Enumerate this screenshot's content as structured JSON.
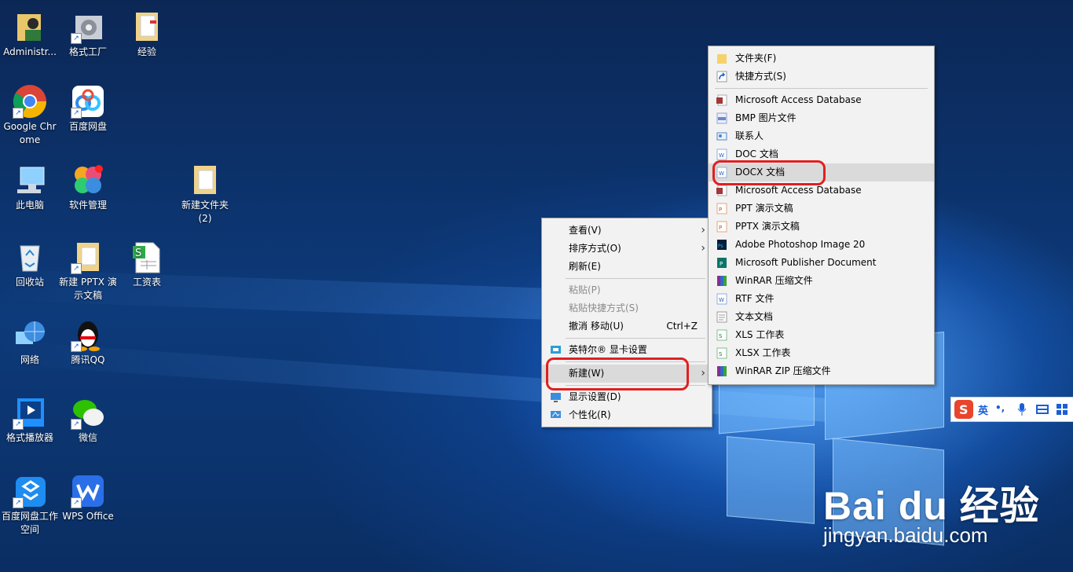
{
  "desktop": {
    "icons": [
      {
        "label": "Administr..."
      },
      {
        "label": "格式工厂"
      },
      {
        "label": "经验"
      },
      {
        "label": "Google Chrome"
      },
      {
        "label": "百度网盘"
      },
      {
        "label": "此电脑"
      },
      {
        "label": "软件管理"
      },
      {
        "label": "新建文件夹 (2)"
      },
      {
        "label": "回收站"
      },
      {
        "label": "新建 PPTX 演示文稿"
      },
      {
        "label": "工资表"
      },
      {
        "label": "网络"
      },
      {
        "label": "腾讯QQ"
      },
      {
        "label": "格式播放器"
      },
      {
        "label": "微信"
      },
      {
        "label": "百度网盘工作空间"
      },
      {
        "label": "WPS Office"
      }
    ]
  },
  "context_menu": {
    "items": [
      {
        "label": "查看(V)"
      },
      {
        "label": "排序方式(O)"
      },
      {
        "label": "刷新(E)"
      },
      {
        "label": "粘贴(P)"
      },
      {
        "label": "粘贴快捷方式(S)"
      },
      {
        "label": "撤消 移动(U)",
        "shortcut": "Ctrl+Z"
      },
      {
        "label": "英特尔® 显卡设置"
      },
      {
        "label": "新建(W)"
      },
      {
        "label": "显示设置(D)"
      },
      {
        "label": "个性化(R)"
      }
    ]
  },
  "new_submenu": {
    "items": [
      {
        "label": "文件夹(F)"
      },
      {
        "label": "快捷方式(S)"
      },
      {
        "label": "Microsoft Access Database"
      },
      {
        "label": "BMP 图片文件"
      },
      {
        "label": "联系人"
      },
      {
        "label": "DOC 文档"
      },
      {
        "label": "DOCX 文档"
      },
      {
        "label": "Microsoft Access Database"
      },
      {
        "label": "PPT 演示文稿"
      },
      {
        "label": "PPTX 演示文稿"
      },
      {
        "label": "Adobe Photoshop Image 20"
      },
      {
        "label": "Microsoft Publisher Document"
      },
      {
        "label": "WinRAR 压缩文件"
      },
      {
        "label": "RTF 文件"
      },
      {
        "label": "文本文档"
      },
      {
        "label": "XLS 工作表"
      },
      {
        "label": "XLSX 工作表"
      },
      {
        "label": "WinRAR ZIP 压缩文件"
      }
    ]
  },
  "ime": {
    "lang": "英"
  },
  "watermark": {
    "logo": "Bai du 经验",
    "url": "jingyan.baidu.com"
  }
}
